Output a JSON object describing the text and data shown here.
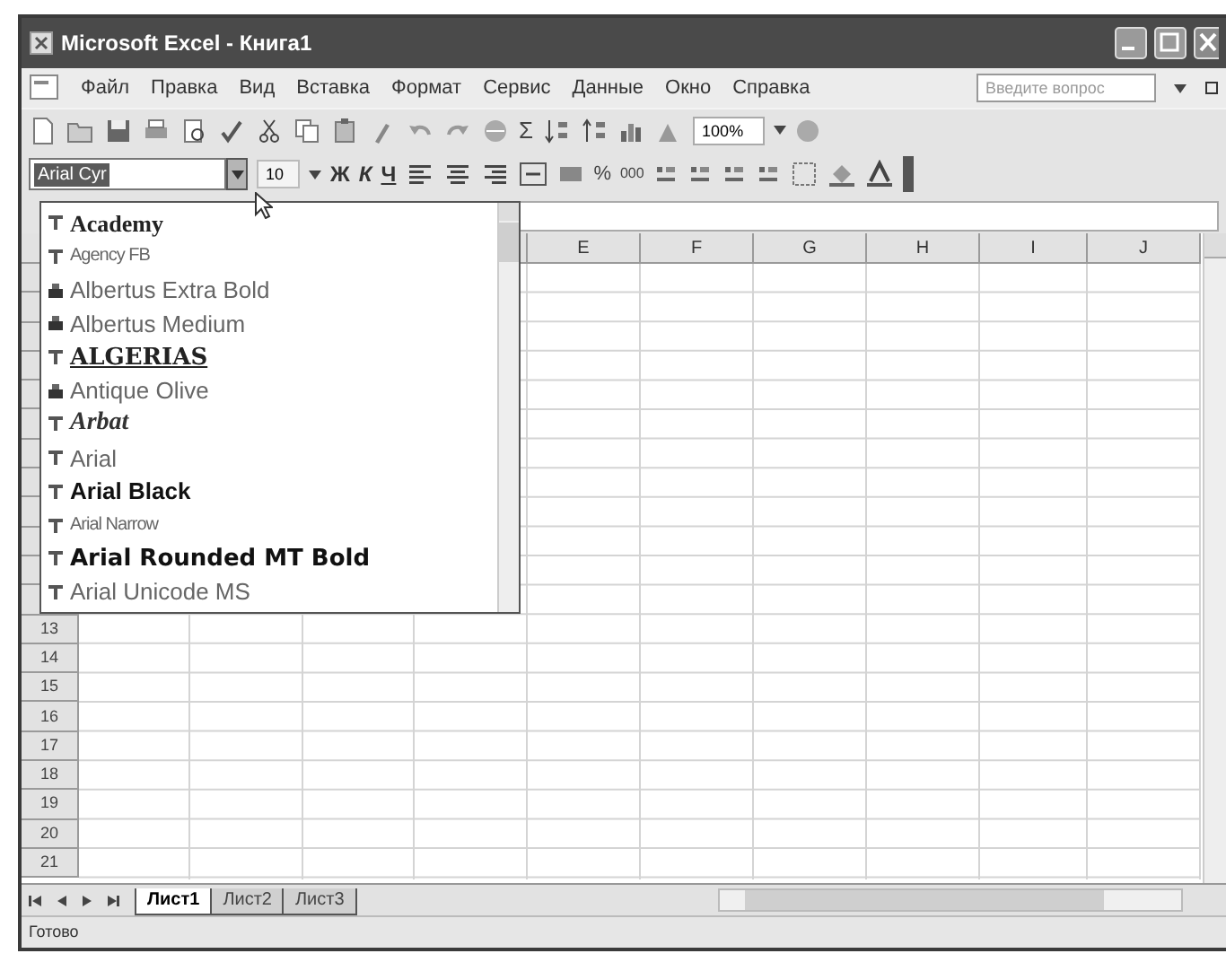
{
  "window": {
    "title": "Microsoft Excel - Книга1"
  },
  "menu": [
    "Файл",
    "Правка",
    "Вид",
    "Вставка",
    "Формат",
    "Сервис",
    "Данные",
    "Окно",
    "Справка"
  ],
  "help_box": {
    "placeholder": "Введите вопрос"
  },
  "standard_toolbar": {
    "sum_button": "Σ",
    "zoom": "100%"
  },
  "formatting_toolbar": {
    "font_box": {
      "value": "Arial Cyr",
      "expanded": true
    },
    "font_size": "10",
    "style_buttons": [
      "Ж",
      "К",
      "Ч"
    ],
    "percent_button": "%",
    "thousands_button": "000"
  },
  "font_list": [
    {
      "label": "Academy",
      "kind": "truetype"
    },
    {
      "label": "Agency FB",
      "kind": "truetype"
    },
    {
      "label": "Albertus Extra Bold",
      "kind": "printer"
    },
    {
      "label": "Albertus Medium",
      "kind": "printer"
    },
    {
      "label": "ALGERIAS",
      "kind": "truetype"
    },
    {
      "label": "Antique Olive",
      "kind": "printer"
    },
    {
      "label": "Arbat",
      "kind": "truetype"
    },
    {
      "label": "Arial",
      "kind": "truetype"
    },
    {
      "label": "Arial Black",
      "kind": "truetype"
    },
    {
      "label": "Arial Narrow",
      "kind": "truetype"
    },
    {
      "label": "Arial Rounded MT Bold",
      "kind": "truetype"
    },
    {
      "label": "Arial Unicode MS",
      "kind": "truetype"
    }
  ],
  "columns": [
    "E",
    "F",
    "G",
    "H",
    "I",
    "J"
  ],
  "rows": [
    "13",
    "14",
    "15",
    "16",
    "17",
    "18",
    "19",
    "20",
    "21"
  ],
  "sheet_tabs": [
    {
      "label": "Лист1",
      "selected": true
    },
    {
      "label": "Лист2",
      "selected": false
    },
    {
      "label": "Лист3",
      "selected": false
    }
  ],
  "status_bar": "Готово"
}
